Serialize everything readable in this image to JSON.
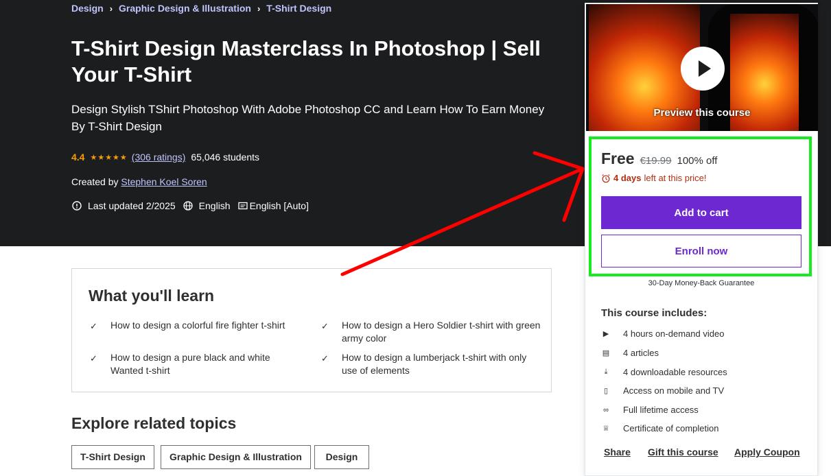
{
  "breadcrumb": [
    "Design",
    "Graphic Design & Illustration",
    "T-Shirt Design"
  ],
  "course": {
    "title": "T-Shirt Design Masterclass In Photoshop | Sell Your T-Shirt",
    "subtitle": "Design Stylish TShirt Photoshop With Adobe Photoshop CC and Learn How To Earn Money By T-Shirt Design",
    "rating": "4.4",
    "stars": 4.4,
    "ratings_count": "(306 ratings)",
    "students": "65,046 students",
    "created_by_label": "Created by",
    "author": "Stephen Koel Soren",
    "last_updated": "Last updated 2/2025",
    "language": "English",
    "captions": "English [Auto]"
  },
  "learn": {
    "heading": "What you'll learn",
    "items": [
      "How to design a colorful fire fighter t-shirt",
      "How to design a Hero Soldier t-shirt with green army color",
      "How to design a pure black and white Wanted t-shirt",
      "How to design a lumberjack t-shirt with only use of elements"
    ]
  },
  "related": {
    "heading": "Explore related topics",
    "tags": [
      "T-Shirt Design",
      "Graphic Design & Illustration",
      "Design"
    ]
  },
  "card": {
    "preview_label": "Preview this course",
    "price": "Free",
    "original_price": "€19.99",
    "discount": "100% off",
    "timer_bold": "4 days",
    "timer_rest": "left at this price!",
    "add_to_cart": "Add to cart",
    "enroll_now": "Enroll now",
    "guarantee": "30-Day Money-Back Guarantee",
    "includes_title": "This course includes:",
    "includes": [
      {
        "icon": "video-icon",
        "text": "4 hours on-demand video"
      },
      {
        "icon": "article-icon",
        "text": "4 articles"
      },
      {
        "icon": "download-icon",
        "text": "4 downloadable resources"
      },
      {
        "icon": "mobile-icon",
        "text": "Access on mobile and TV"
      },
      {
        "icon": "infinity-icon",
        "text": "Full lifetime access"
      },
      {
        "icon": "trophy-icon",
        "text": "Certificate of completion"
      }
    ],
    "share": "Share",
    "gift": "Gift this course",
    "coupon": "Apply Coupon"
  },
  "colors": {
    "hero_bg": "#1c1d1f",
    "link": "#c0c4fc",
    "star": "#f69c08",
    "purple": "#6d28d2",
    "timer": "#b32d0f",
    "highlight": "#18ea20",
    "annotation_arrow": "#ff0000"
  }
}
